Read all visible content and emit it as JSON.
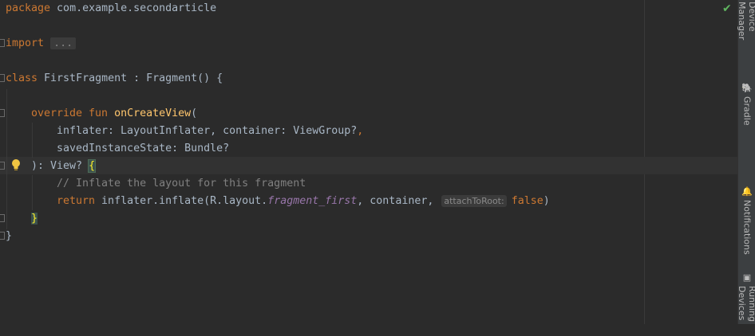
{
  "code": {
    "package_kw": "package",
    "package_name": " com.example.secondarticle",
    "import_kw": "import",
    "import_folded": "...",
    "class_kw": "class",
    "class_sig": " FirstFragment : Fragment() {",
    "override_kw": "override fun",
    "fn_name": "onCreateView",
    "fn_open": "(",
    "param1": "inflater: LayoutInflater, container: ViewGroup?",
    "comma": ",",
    "param2": "savedInstanceState: Bundle?",
    "return_sig": "): View? ",
    "open_brace": "{",
    "comment": "// Inflate the layout for this fragment",
    "return_kw": "return",
    "inflate_call": " inflater.inflate(R.layout.",
    "layout_ref": "fragment_first",
    "container_arg": ", container,",
    "hint_label": "attachToRoot:",
    "false_kw": "false",
    "close_paren": ")",
    "close_brace": "}",
    "class_close": "}"
  },
  "tool_windows": {
    "device_manager": "Device Manager",
    "gradle": "Gradle",
    "notifications": "Notifications",
    "running_devices": "Running Devices"
  },
  "icons": {
    "inspection_ok": "check-icon",
    "intention": "lightbulb-icon"
  }
}
